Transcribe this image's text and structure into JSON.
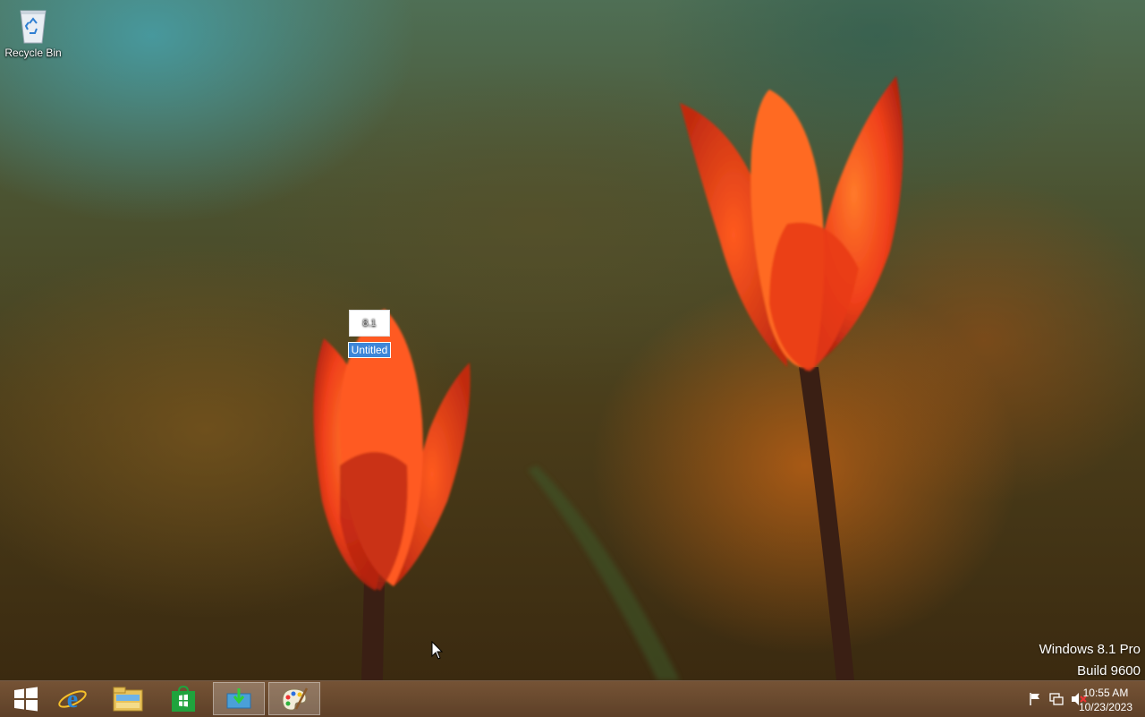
{
  "desktop": {
    "icons": [
      {
        "label": "Recycle Bin"
      },
      {
        "label": "Untitled",
        "thumb_text": "8.1"
      }
    ],
    "watermark": {
      "line1": "Windows 8.1 Pro",
      "line2": "Build 9600"
    }
  },
  "taskbar": {
    "items": [
      {
        "name": "Start",
        "icon": "windows-logo-icon"
      },
      {
        "name": "Internet Explorer",
        "icon": "ie-icon"
      },
      {
        "name": "File Explorer",
        "icon": "folder-icon"
      },
      {
        "name": "Store",
        "icon": "store-icon"
      },
      {
        "name": "Downloader app",
        "icon": "download-app-icon",
        "active": true
      },
      {
        "name": "Paint",
        "icon": "paint-icon",
        "active": true
      }
    ],
    "tray": {
      "icons": [
        "action-center-flag-icon",
        "network-icon",
        "volume-muted-icon"
      ],
      "time": "10:55 AM",
      "date": "10/23/2023"
    }
  },
  "colors": {
    "selection": "#3d86d9",
    "taskbar": "#6e4c30",
    "tulip": "#ff4a18"
  }
}
